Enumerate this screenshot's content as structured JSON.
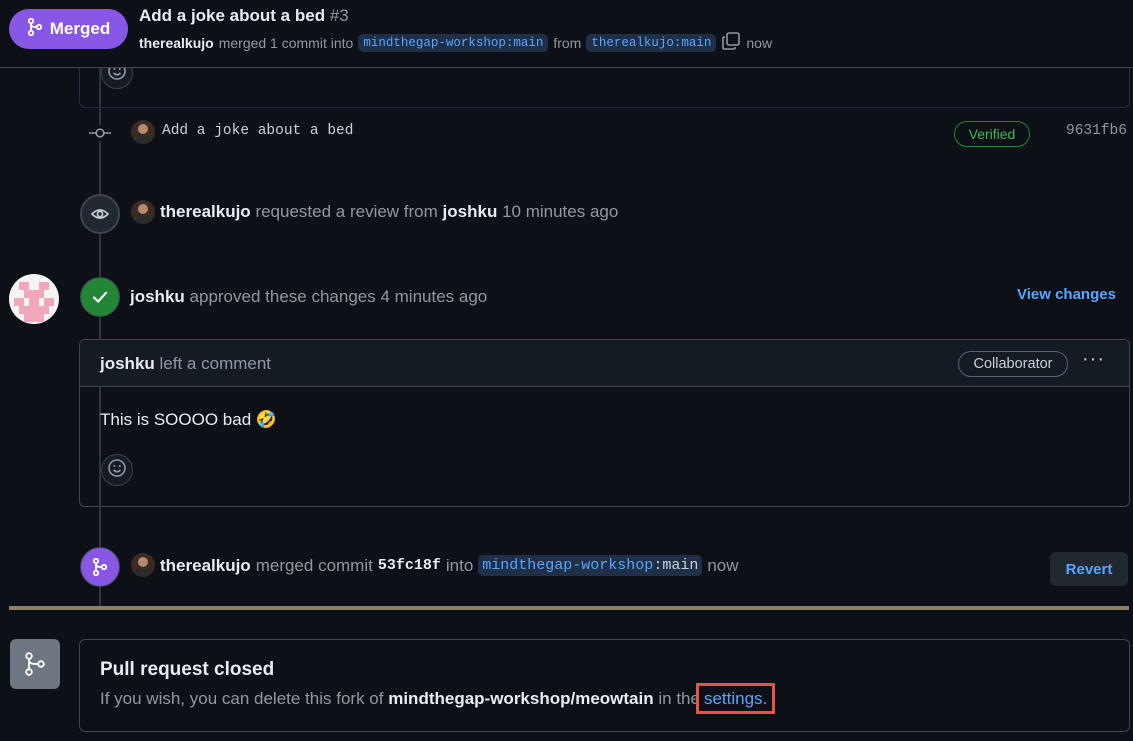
{
  "header": {
    "status_label": "Merged",
    "pr_title": "Add a joke about a bed",
    "pr_number": "#3",
    "author": "therealkujo",
    "merged_text": "merged 1 commit into",
    "base_branch": "mindthegap-workshop:main",
    "from_text": "from",
    "head_branch": "therealkujo:main",
    "time": "now"
  },
  "commit": {
    "message": "Add a joke about a bed",
    "verified_label": "Verified",
    "sha": "9631fb6"
  },
  "review_request": {
    "author": "therealkujo",
    "text": "requested a review from",
    "reviewer": "joshku",
    "time": "10 minutes ago"
  },
  "approval": {
    "author": "joshku",
    "text": "approved these changes",
    "time": "4 minutes ago",
    "view_changes": "View changes"
  },
  "review_comment": {
    "author": "joshku",
    "action": "left a comment",
    "role_badge": "Collaborator",
    "more": "···",
    "body": "This is SOOOO bad 🤣"
  },
  "merge_event": {
    "author": "therealkujo",
    "text": "merged commit",
    "sha": "53fc18f",
    "into": "into",
    "branch_owner": "mindthegap-workshop",
    "branch_sep": ":",
    "branch_name": "main",
    "time": "now",
    "revert_label": "Revert"
  },
  "closed": {
    "title": "Pull request closed",
    "text_before": "If you wish, you can delete this fork of",
    "repo": "mindthegap-workshop/meowtain",
    "text_after": "in the",
    "link": "settings."
  },
  "colors": {
    "merged_purple": "#8957e5",
    "approved_green": "#238636",
    "link_blue": "#58a6ff",
    "highlight_red": "#e5534b"
  },
  "icons": [
    "git-merge-icon",
    "copy-icon",
    "smiley-icon",
    "commit-icon",
    "eye-icon",
    "check-icon",
    "kebab-icon",
    "git-branch-icon"
  ]
}
